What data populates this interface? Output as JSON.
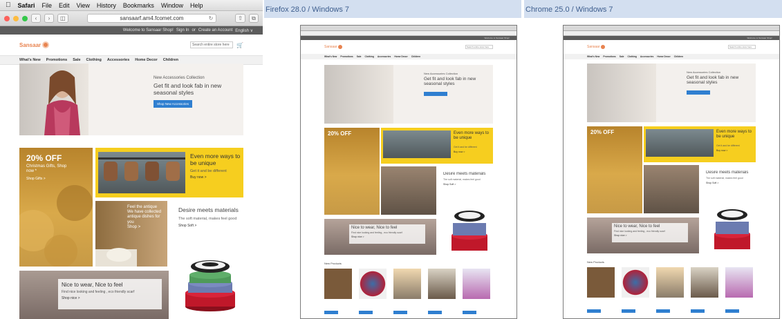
{
  "captions": {
    "firefox": "Firefox 28.0 / Windows 7",
    "chrome": "Chrome 25.0 / Windows 7"
  },
  "safari": {
    "menubar": [
      "Safari",
      "File",
      "Edit",
      "View",
      "History",
      "Bookmarks",
      "Window",
      "Help"
    ],
    "url": "sansaarf.am4.fcomet.com"
  },
  "site": {
    "topbar": {
      "welcome": "Welcome to Sansaar Shop!",
      "sign_in": "Sign In",
      "or": "or",
      "create": "Create an Account",
      "language": "English ∨"
    },
    "logo_text": "Sansaar",
    "search_placeholder": "Search entire store here",
    "nav": [
      "What's New",
      "Promotions",
      "Sale",
      "Clothing",
      "Accessories",
      "Home Decor",
      "Children"
    ],
    "hero": {
      "kicker": "New Accessories Collection",
      "headline": "Get fit and look fab in new seasonal styles",
      "button": "Shop New Accessories"
    },
    "promo_autumn": {
      "title": "20% OFF",
      "subtitle": "Christmas Gifts, Shop now *",
      "link": "Shop Gifts >"
    },
    "promo_bags": {
      "title": "Even more ways to be unique",
      "subtitle": "Get it and be different",
      "link": "Buy now >"
    },
    "promo_antique": {
      "title": "Feel the antique",
      "subtitle": "We have collected antique dishes for you",
      "link": "Shop >"
    },
    "promo_soft": {
      "title": "Desire meets materials",
      "subtitle": "The soft material, makes feel good",
      "link": "Shop Soft >"
    },
    "promo_wear": {
      "title": "Nice to wear, Nice to feel",
      "subtitle": "Find nice looking and feeling , eco friendly scarf",
      "link": "Shop nice >"
    },
    "new_products_label": "New Products"
  },
  "colors": {
    "accent_blue": "#2f7fd0",
    "promo_yellow": "#f6ce1f",
    "logo_orange": "#e8834f",
    "caption_bg": "#d3dff0",
    "caption_text": "#3e5e8e"
  }
}
